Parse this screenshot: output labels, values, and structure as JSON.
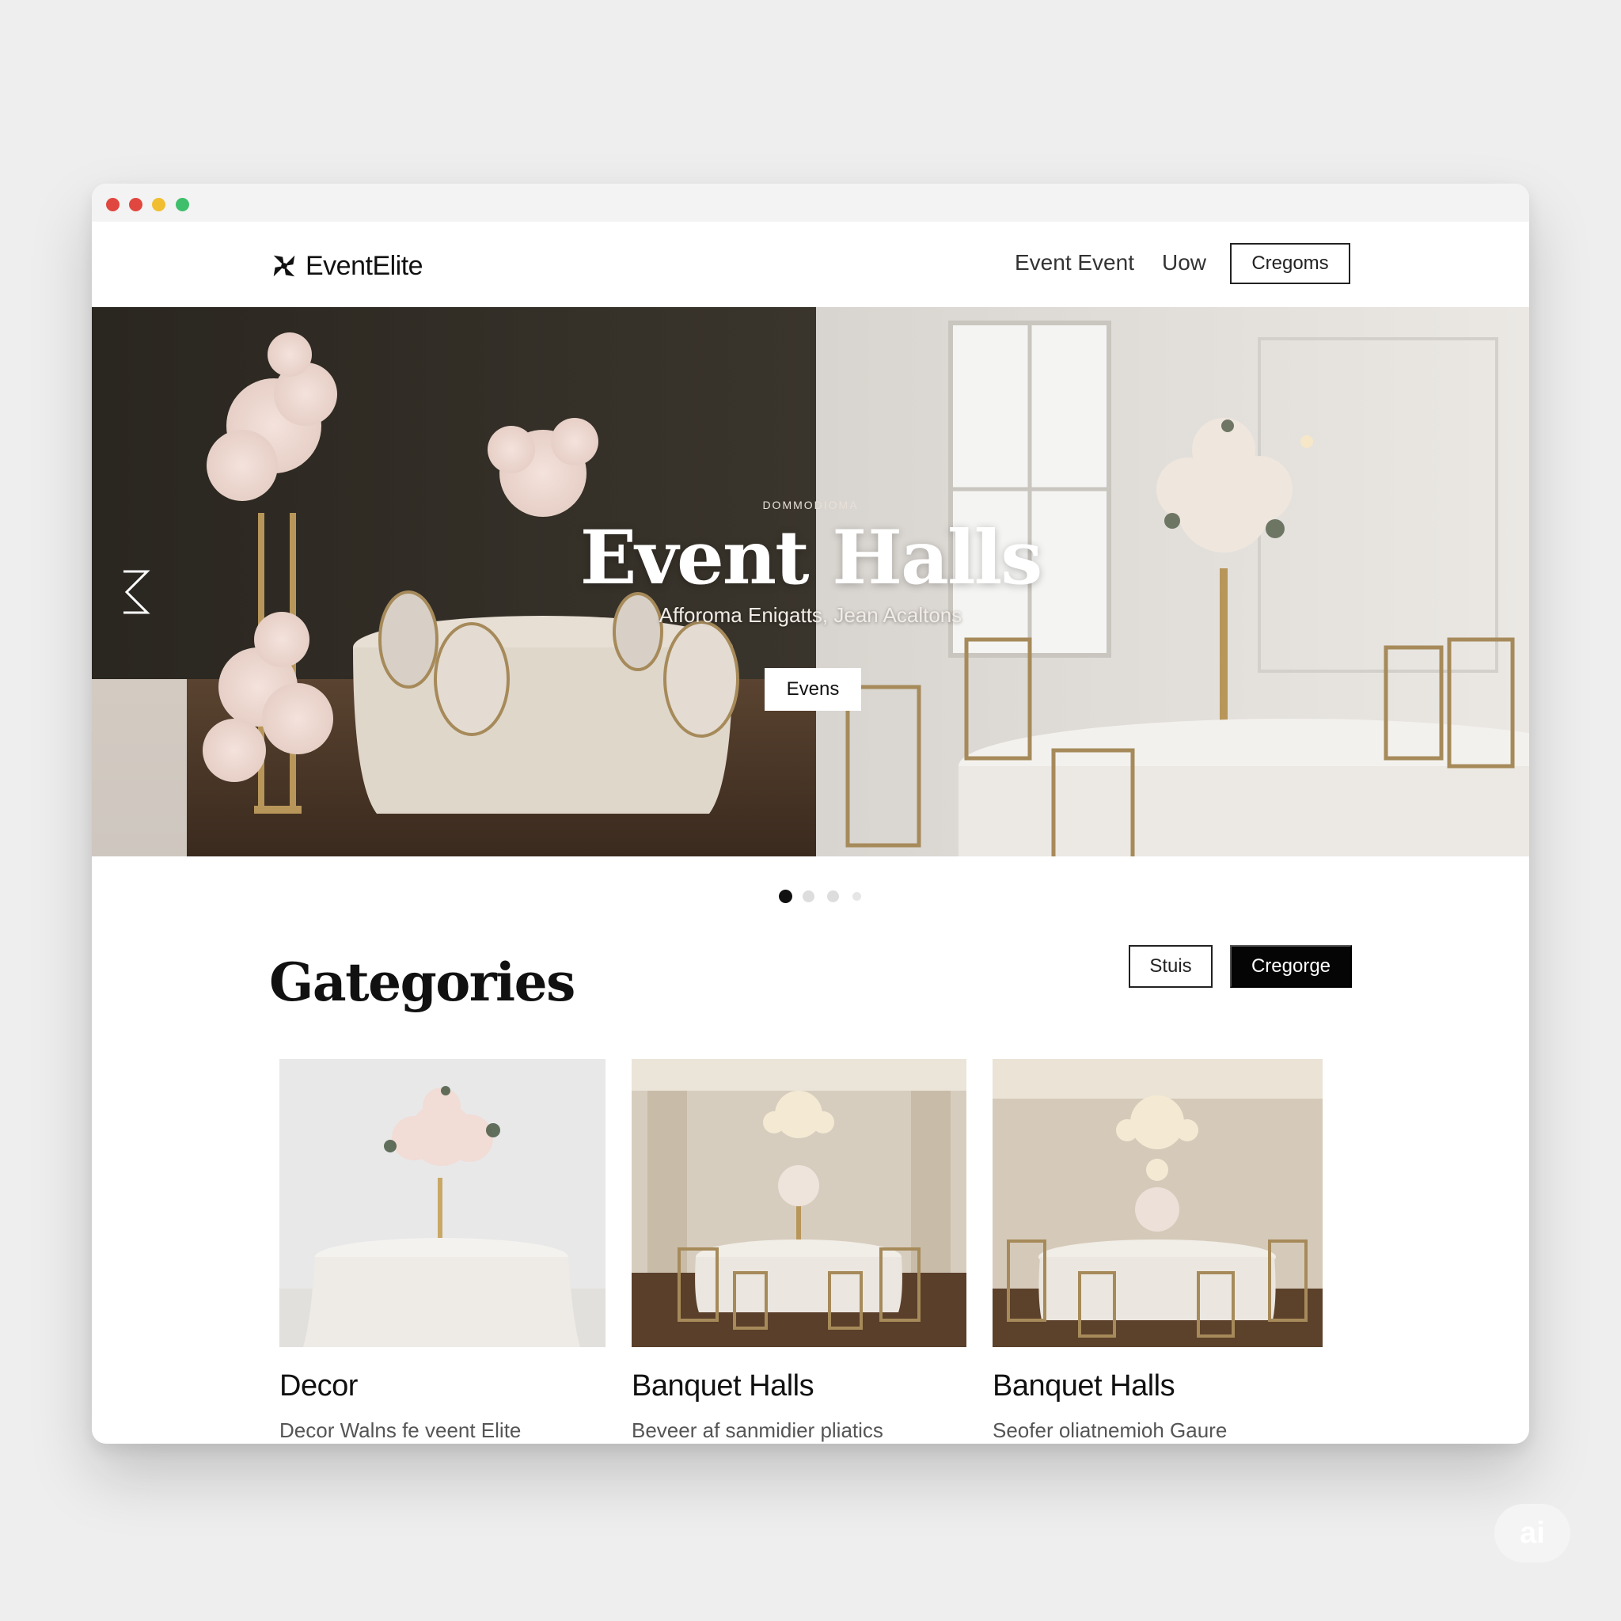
{
  "brand": {
    "name": "EventElite"
  },
  "nav": {
    "links": [
      "Event Event",
      "Uow"
    ],
    "button_label": "Cregoms"
  },
  "hero": {
    "eyebrow": "DOMMODIOMA",
    "title": "Event Halls",
    "subtitle": "Afforoma Enigatts, Jean Acaltons",
    "cta_label": "Evens",
    "slide_count": 4,
    "active_slide": 1
  },
  "categories": {
    "title": "Gategories",
    "filter_outline_label": "Stuis",
    "filter_solid_label": "Cregorge",
    "cards": [
      {
        "title": "Decor",
        "description": "Decor Walns fe veent Elite"
      },
      {
        "title": "Banquet Halls",
        "description": "Beveer af sanmidier pliatics"
      },
      {
        "title": "Banquet Halls",
        "description": "Seofer oliatnemioh Gaure"
      }
    ]
  },
  "watermark": {
    "label": "ai"
  },
  "colors": {
    "accent_dark": "#050505",
    "page_bg": "#eeeeee",
    "window_dots": [
      "#e0473f",
      "#e0473f",
      "#f1be32",
      "#3fbf6b"
    ]
  }
}
